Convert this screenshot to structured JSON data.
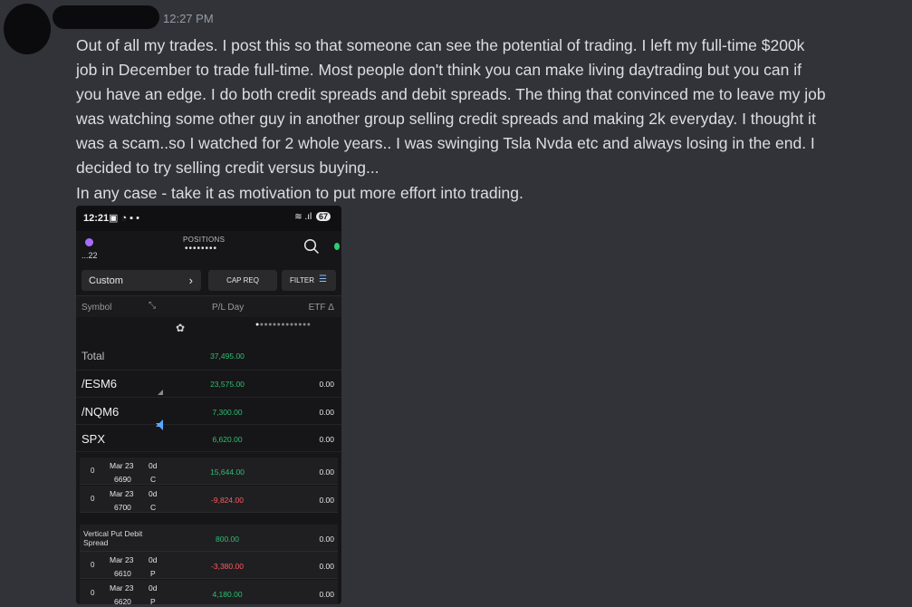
{
  "message": {
    "timestamp": "12:27 PM",
    "lines": [
      "Out of all my trades.  I post this so that someone can see the potential of trading. I left my full-time $200k",
      "job in December to trade full-time. Most people don't think you can make living daytrading but you can if",
      "you have an edge. I do both credit spreads and debit spreads.  The thing that convinced me to leave my job",
      "was watching some other guy in another group selling credit spreads and making 2k everyday. I thought it",
      "was a scam..so I watched for 2 whole years.. I was swinging Tsla Nvda etc and always losing in the end. I",
      "decided to try selling credit versus buying...",
      "In any case - take it as motivation to put more effort into trading."
    ]
  },
  "phone": {
    "status": {
      "time": "12:21",
      "battery": "67"
    },
    "header": {
      "account": "...22",
      "title": "POSITIONS",
      "masked": "••••••••"
    },
    "controls": {
      "view": "Custom",
      "cap_req": "CAP REQ",
      "filter": "FILTER"
    },
    "columns": {
      "symbol": "Symbol",
      "pl": "P/L Day",
      "etf": "ETF Δ"
    },
    "total": {
      "label": "Total",
      "pl": "37,495.00"
    },
    "symbols": [
      {
        "name": "/ESM6",
        "pl": "23,575.00",
        "etf": "0.00"
      },
      {
        "name": "/NQM6",
        "pl": "7,300.00",
        "etf": "0.00"
      },
      {
        "name": "SPX",
        "pl": "6,620.00",
        "etf": "0.00"
      }
    ],
    "options_spx": [
      {
        "qty": "0",
        "exp": "Mar 23",
        "dte": "0d",
        "strike": "6690",
        "type": "C",
        "pl": "15,644.00",
        "etf": "0.00"
      },
      {
        "qty": "0",
        "exp": "Mar 23",
        "dte": "0d",
        "strike": "6700",
        "type": "C",
        "pl": "-9,824.00",
        "etf": "0.00"
      }
    ],
    "group": {
      "label": "Vertical Put Debit Spread",
      "pl": "800.00",
      "etf": "0.00"
    },
    "options_group": [
      {
        "qty": "0",
        "exp": "Mar 23",
        "dte": "0d",
        "strike": "6610",
        "type": "P",
        "pl": "-3,380.00",
        "etf": "0.00"
      },
      {
        "qty": "0",
        "exp": "Mar 23",
        "dte": "0d",
        "strike": "6620",
        "type": "P",
        "pl": "4,180.00",
        "etf": "0.00"
      }
    ]
  }
}
